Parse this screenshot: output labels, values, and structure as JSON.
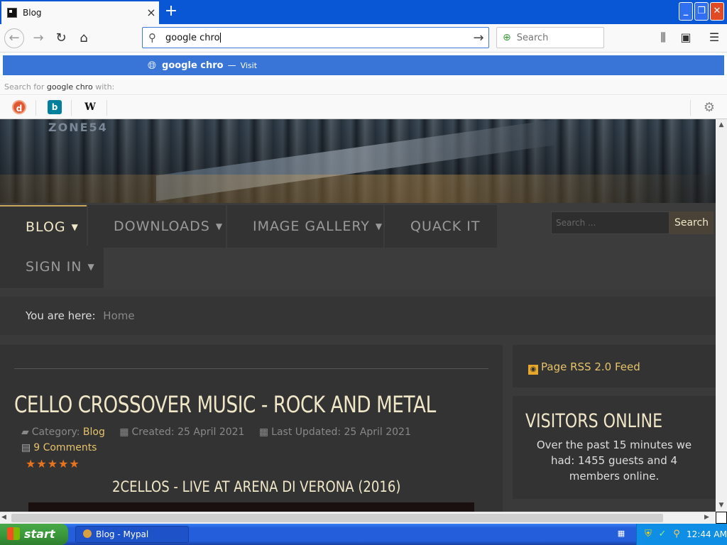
{
  "browser": {
    "tab_title": "Blog",
    "tab_close": "×",
    "new_tab": "+",
    "url_text": "google chro",
    "search_placeholder": "Search",
    "suggestion": {
      "text": "google chro",
      "dash": "—",
      "action": "Visit"
    },
    "search_for_prefix": "Search for",
    "search_for_query": "google chro",
    "search_for_suffix": "with:",
    "engines": [
      "DuckDuckGo",
      "Bing",
      "Wikipedia"
    ]
  },
  "site": {
    "logo": "ZONE54",
    "menu": [
      {
        "label": "BLOG"
      },
      {
        "label": "DOWNLOADS"
      },
      {
        "label": "IMAGE GALLERY"
      },
      {
        "label": "QUACK IT"
      },
      {
        "label": "SIGN IN"
      }
    ],
    "search_placeholder": "Search ...",
    "search_button": "Search",
    "breadcrumb_label": "You are here:",
    "breadcrumb_home": "Home",
    "article": {
      "title": "CELLO CROSSOVER MUSIC - ROCK AND METAL",
      "category_label": "Category:",
      "category_value": "Blog",
      "created": "Created: 25 April 2021",
      "updated": "Last Updated: 25 April 2021",
      "comments": "9 Comments",
      "rating": 5,
      "rating_stars": "★★★★★",
      "video_title": "2CELLOS - LIVE AT ARENA DI VERONA (2016)"
    },
    "rss_label": "Page RSS 2.0 Feed",
    "visitors": {
      "title": "VISITORS ONLINE",
      "text": "Over the past 15 minutes we had: 1455 guests and 4 members online."
    }
  },
  "taskbar": {
    "start_label": "start",
    "task_item": "Blog - Mypal",
    "clock": "12:44 AM"
  },
  "colors": {
    "titlebar": "#0a57d6",
    "suggestion_highlight": "#3875d7",
    "site_accent": "#e6c36a",
    "site_bg": "#3a3a3a",
    "taskbar": "#245edb",
    "start_button": "#3c9a3c"
  }
}
